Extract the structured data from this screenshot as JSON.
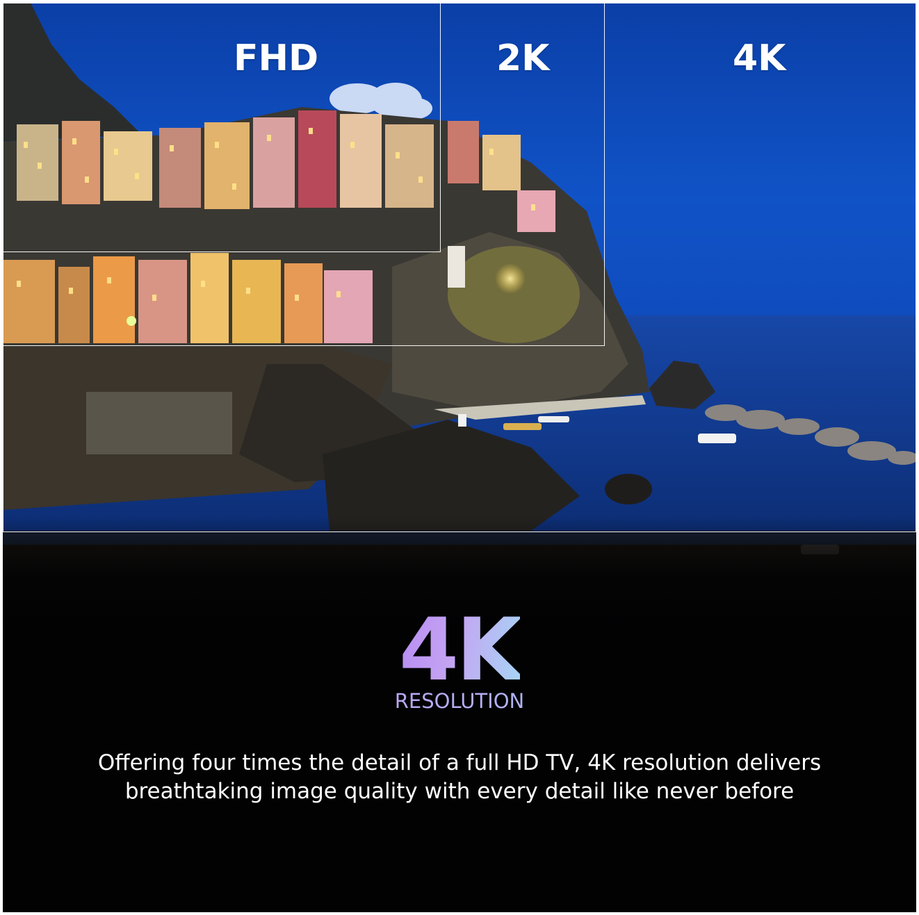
{
  "resolution_boxes": [
    {
      "label": "FHD"
    },
    {
      "label": "2K"
    },
    {
      "label": "4K"
    }
  ],
  "headline": {
    "title": "4K",
    "subtitle": "RESOLUTION"
  },
  "description": {
    "text": "Offering four times the detail of a full HD TV, 4K resolution delivers breathtaking image quality with every detail like never before"
  },
  "colors": {
    "sky": "#0e49b8",
    "sea": "#123d9a",
    "background": "#020203",
    "gradient_purple": "#b78cf3",
    "gradient_blue": "#a6d6f5"
  }
}
